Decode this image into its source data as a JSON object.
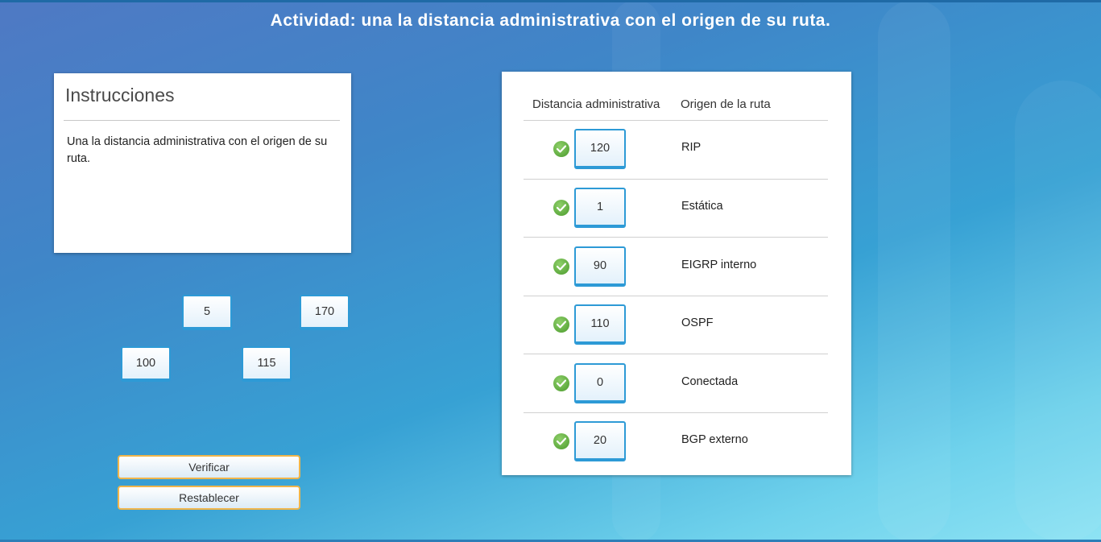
{
  "title": "Actividad: una la distancia administrativa con el origen de su ruta.",
  "instructions": {
    "heading": "Instrucciones",
    "text": "Una la distancia administrativa con el origen de su ruta."
  },
  "pool_tiles": [
    "5",
    "170",
    "100",
    "115"
  ],
  "buttons": {
    "verify": "Verificar",
    "reset": "Restablecer"
  },
  "table": {
    "col_distance": "Distancia administrativa",
    "col_origin": "Origen de la ruta",
    "rows": [
      {
        "value": "120",
        "origin": "RIP",
        "status": "correct"
      },
      {
        "value": "1",
        "origin": "Estática",
        "status": "correct"
      },
      {
        "value": "90",
        "origin": "EIGRP interno",
        "status": "correct"
      },
      {
        "value": "110",
        "origin": "OSPF",
        "status": "correct"
      },
      {
        "value": "0",
        "origin": "Conectada",
        "status": "correct"
      },
      {
        "value": "20",
        "origin": "BGP externo",
        "status": "correct"
      }
    ]
  },
  "colors": {
    "tile_border": "#2d9ad6",
    "button_border": "#f0b54a",
    "check": "#5aa935"
  },
  "icons": {
    "row_status": "check-circle-icon"
  }
}
